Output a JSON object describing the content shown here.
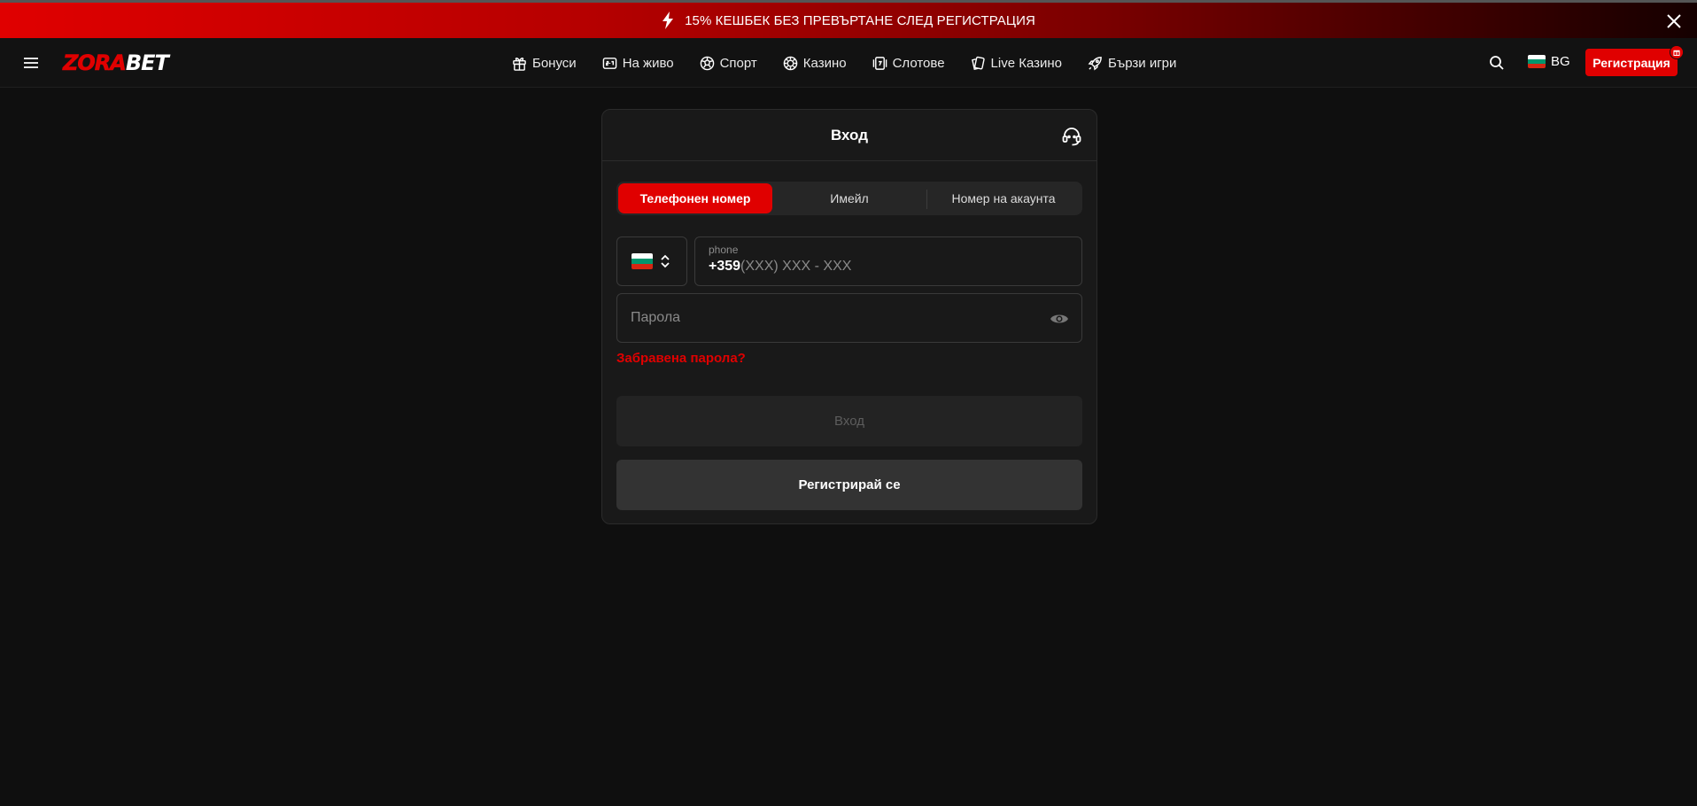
{
  "promo": {
    "text": "15% КЕШБЕК БЕЗ ПРЕВЪРТАНЕ СЛЕД РЕГИСТРАЦИЯ",
    "icon": "bolt-icon",
    "close_icon": "close-icon"
  },
  "header": {
    "logo": {
      "part1": "ZORA",
      "part2": "BET"
    },
    "nav": [
      {
        "label": "Бонуси",
        "icon": "gift-icon"
      },
      {
        "label": "На живо",
        "icon": "live-score-icon"
      },
      {
        "label": "Спорт",
        "icon": "soccer-ball-icon"
      },
      {
        "label": "Казино",
        "icon": "casino-chip-icon"
      },
      {
        "label": "Слотове",
        "icon": "slot-machine-icon"
      },
      {
        "label": "Live Казино",
        "icon": "cards-icon"
      },
      {
        "label": "Бързи игри",
        "icon": "rocket-icon"
      }
    ],
    "language": "BG",
    "register_label": "Регистрация"
  },
  "login": {
    "title": "Вход",
    "tabs": [
      {
        "label": "Телефонен номер",
        "active": true
      },
      {
        "label": "Имейл",
        "active": false
      },
      {
        "label": "Номер на акаунта",
        "active": false
      }
    ],
    "country_flag": "bulgaria-flag",
    "phone": {
      "label": "phone",
      "prefix": "+359",
      "mask": "(XXX) XXX - XXX"
    },
    "password_placeholder": "Парола",
    "forgot_label": "Забравена парола?",
    "submit_label": "Вход",
    "register_label": "Регистрирай се"
  },
  "colors": {
    "accent": "#e00000",
    "background": "#0f0f0f",
    "card": "#191919"
  }
}
